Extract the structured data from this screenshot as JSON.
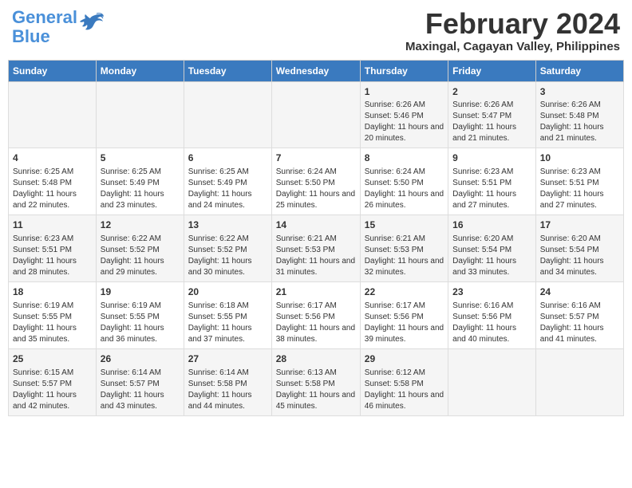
{
  "header": {
    "logo_general": "General",
    "logo_blue": "Blue",
    "month_title": "February 2024",
    "location": "Maxingal, Cagayan Valley, Philippines"
  },
  "days_of_week": [
    "Sunday",
    "Monday",
    "Tuesday",
    "Wednesday",
    "Thursday",
    "Friday",
    "Saturday"
  ],
  "weeks": [
    [
      {
        "day": "",
        "info": ""
      },
      {
        "day": "",
        "info": ""
      },
      {
        "day": "",
        "info": ""
      },
      {
        "day": "",
        "info": ""
      },
      {
        "day": "1",
        "info": "Sunrise: 6:26 AM\nSunset: 5:46 PM\nDaylight: 11 hours and 20 minutes."
      },
      {
        "day": "2",
        "info": "Sunrise: 6:26 AM\nSunset: 5:47 PM\nDaylight: 11 hours and 21 minutes."
      },
      {
        "day": "3",
        "info": "Sunrise: 6:26 AM\nSunset: 5:48 PM\nDaylight: 11 hours and 21 minutes."
      }
    ],
    [
      {
        "day": "4",
        "info": "Sunrise: 6:25 AM\nSunset: 5:48 PM\nDaylight: 11 hours and 22 minutes."
      },
      {
        "day": "5",
        "info": "Sunrise: 6:25 AM\nSunset: 5:49 PM\nDaylight: 11 hours and 23 minutes."
      },
      {
        "day": "6",
        "info": "Sunrise: 6:25 AM\nSunset: 5:49 PM\nDaylight: 11 hours and 24 minutes."
      },
      {
        "day": "7",
        "info": "Sunrise: 6:24 AM\nSunset: 5:50 PM\nDaylight: 11 hours and 25 minutes."
      },
      {
        "day": "8",
        "info": "Sunrise: 6:24 AM\nSunset: 5:50 PM\nDaylight: 11 hours and 26 minutes."
      },
      {
        "day": "9",
        "info": "Sunrise: 6:23 AM\nSunset: 5:51 PM\nDaylight: 11 hours and 27 minutes."
      },
      {
        "day": "10",
        "info": "Sunrise: 6:23 AM\nSunset: 5:51 PM\nDaylight: 11 hours and 27 minutes."
      }
    ],
    [
      {
        "day": "11",
        "info": "Sunrise: 6:23 AM\nSunset: 5:51 PM\nDaylight: 11 hours and 28 minutes."
      },
      {
        "day": "12",
        "info": "Sunrise: 6:22 AM\nSunset: 5:52 PM\nDaylight: 11 hours and 29 minutes."
      },
      {
        "day": "13",
        "info": "Sunrise: 6:22 AM\nSunset: 5:52 PM\nDaylight: 11 hours and 30 minutes."
      },
      {
        "day": "14",
        "info": "Sunrise: 6:21 AM\nSunset: 5:53 PM\nDaylight: 11 hours and 31 minutes."
      },
      {
        "day": "15",
        "info": "Sunrise: 6:21 AM\nSunset: 5:53 PM\nDaylight: 11 hours and 32 minutes."
      },
      {
        "day": "16",
        "info": "Sunrise: 6:20 AM\nSunset: 5:54 PM\nDaylight: 11 hours and 33 minutes."
      },
      {
        "day": "17",
        "info": "Sunrise: 6:20 AM\nSunset: 5:54 PM\nDaylight: 11 hours and 34 minutes."
      }
    ],
    [
      {
        "day": "18",
        "info": "Sunrise: 6:19 AM\nSunset: 5:55 PM\nDaylight: 11 hours and 35 minutes."
      },
      {
        "day": "19",
        "info": "Sunrise: 6:19 AM\nSunset: 5:55 PM\nDaylight: 11 hours and 36 minutes."
      },
      {
        "day": "20",
        "info": "Sunrise: 6:18 AM\nSunset: 5:55 PM\nDaylight: 11 hours and 37 minutes."
      },
      {
        "day": "21",
        "info": "Sunrise: 6:17 AM\nSunset: 5:56 PM\nDaylight: 11 hours and 38 minutes."
      },
      {
        "day": "22",
        "info": "Sunrise: 6:17 AM\nSunset: 5:56 PM\nDaylight: 11 hours and 39 minutes."
      },
      {
        "day": "23",
        "info": "Sunrise: 6:16 AM\nSunset: 5:56 PM\nDaylight: 11 hours and 40 minutes."
      },
      {
        "day": "24",
        "info": "Sunrise: 6:16 AM\nSunset: 5:57 PM\nDaylight: 11 hours and 41 minutes."
      }
    ],
    [
      {
        "day": "25",
        "info": "Sunrise: 6:15 AM\nSunset: 5:57 PM\nDaylight: 11 hours and 42 minutes."
      },
      {
        "day": "26",
        "info": "Sunrise: 6:14 AM\nSunset: 5:57 PM\nDaylight: 11 hours and 43 minutes."
      },
      {
        "day": "27",
        "info": "Sunrise: 6:14 AM\nSunset: 5:58 PM\nDaylight: 11 hours and 44 minutes."
      },
      {
        "day": "28",
        "info": "Sunrise: 6:13 AM\nSunset: 5:58 PM\nDaylight: 11 hours and 45 minutes."
      },
      {
        "day": "29",
        "info": "Sunrise: 6:12 AM\nSunset: 5:58 PM\nDaylight: 11 hours and 46 minutes."
      },
      {
        "day": "",
        "info": ""
      },
      {
        "day": "",
        "info": ""
      }
    ]
  ]
}
